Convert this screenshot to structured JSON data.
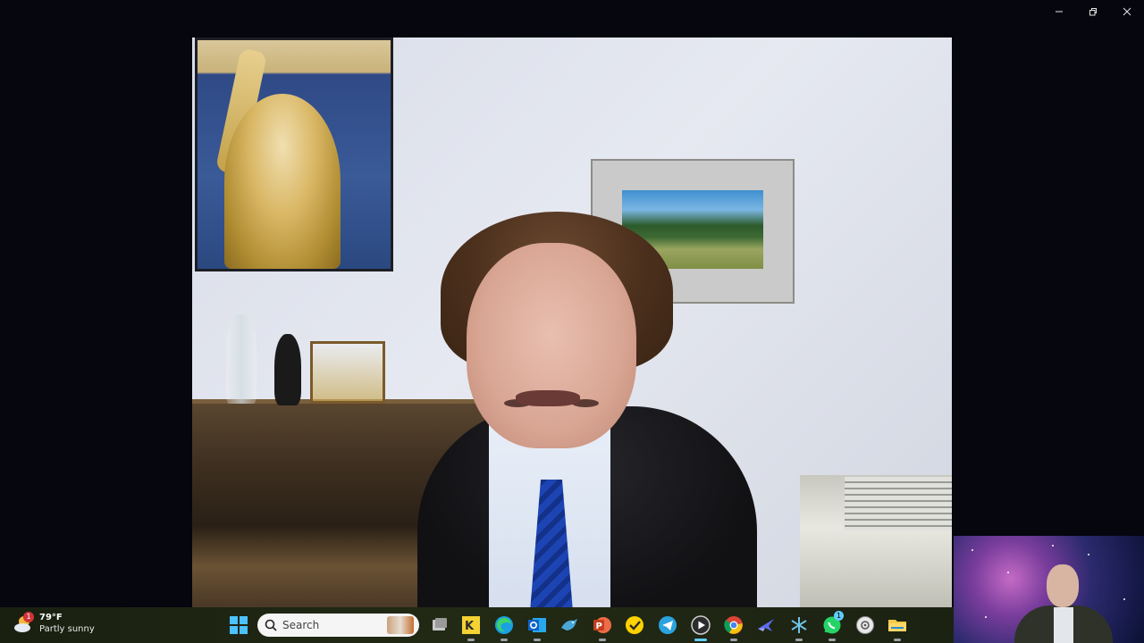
{
  "window": {
    "controls": [
      "minimize-icon",
      "restore-icon",
      "close-icon"
    ]
  },
  "video_call": {
    "main_speaker": "speaker-video",
    "self_view": "self-view-video"
  },
  "taskbar": {
    "weather": {
      "temperature": "79°F",
      "condition": "Partly sunny",
      "badge_count": "1"
    },
    "search": {
      "placeholder": "Search"
    },
    "apps": [
      {
        "name": "task-view-icon"
      },
      {
        "name": "kleopatra-icon"
      },
      {
        "name": "edge-icon"
      },
      {
        "name": "outlook-icon"
      },
      {
        "name": "bird-app-icon"
      },
      {
        "name": "powerpoint-icon"
      },
      {
        "name": "norton-icon"
      },
      {
        "name": "telegram-icon"
      },
      {
        "name": "media-player-icon",
        "active": true
      },
      {
        "name": "chrome-icon"
      },
      {
        "name": "jet-app-icon"
      },
      {
        "name": "star-app-icon"
      },
      {
        "name": "whatsapp-icon",
        "badge": "1"
      },
      {
        "name": "disk-app-icon"
      },
      {
        "name": "file-explorer-icon"
      }
    ]
  },
  "colors": {
    "background": "#05060e",
    "taskbar": "#1e2512",
    "accent": "#60cdff",
    "tie_blue": "#1d44b3"
  }
}
